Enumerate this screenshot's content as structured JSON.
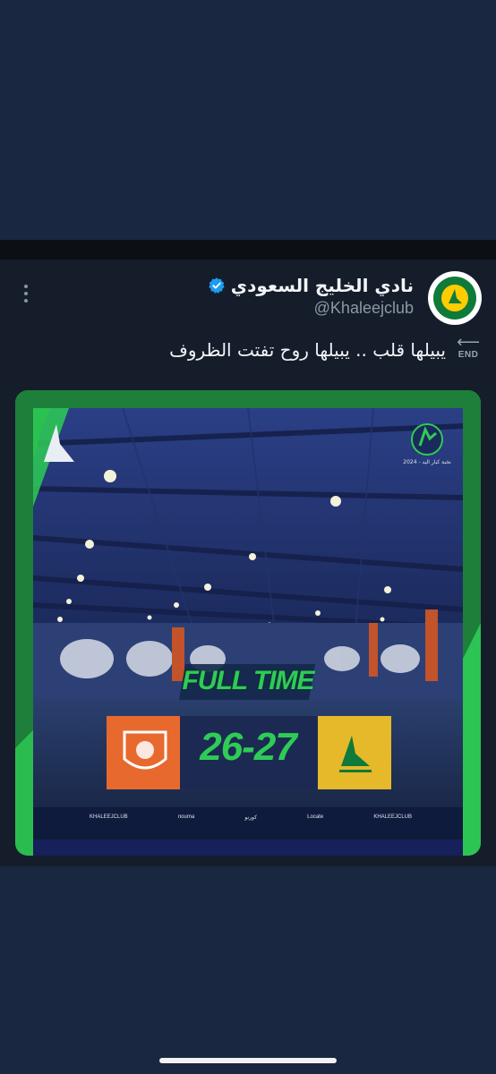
{
  "tweet": {
    "display_name": "نادي الخليج السعودي",
    "handle": "@Khaleejclub",
    "text": "يبيلها قلب .. يبيلها روح تفتت الظروف",
    "emoji_label": "END",
    "icons": {
      "more": "more-vertical-icon",
      "verified": "verified-badge-icon",
      "avatar": "khaleej-club-logo"
    }
  },
  "media": {
    "headline": "FULL TIME",
    "score": "26-27",
    "season_label": "نخبة كبار اليد - 2024",
    "footer_items": [
      "KHALEEJCLUB",
      "nouma",
      "كورنو",
      "Locate",
      "KHALEEJCLUB"
    ],
    "colors": {
      "accent_green": "#2ecc55",
      "away_team_orange": "#e8692e",
      "home_team_yellow": "#e6b92a",
      "arena_blue": "#1f3166"
    }
  },
  "theme": {
    "background": "#192740",
    "tweet_background": "#151d2b",
    "verified_blue": "#1d9bf0"
  }
}
